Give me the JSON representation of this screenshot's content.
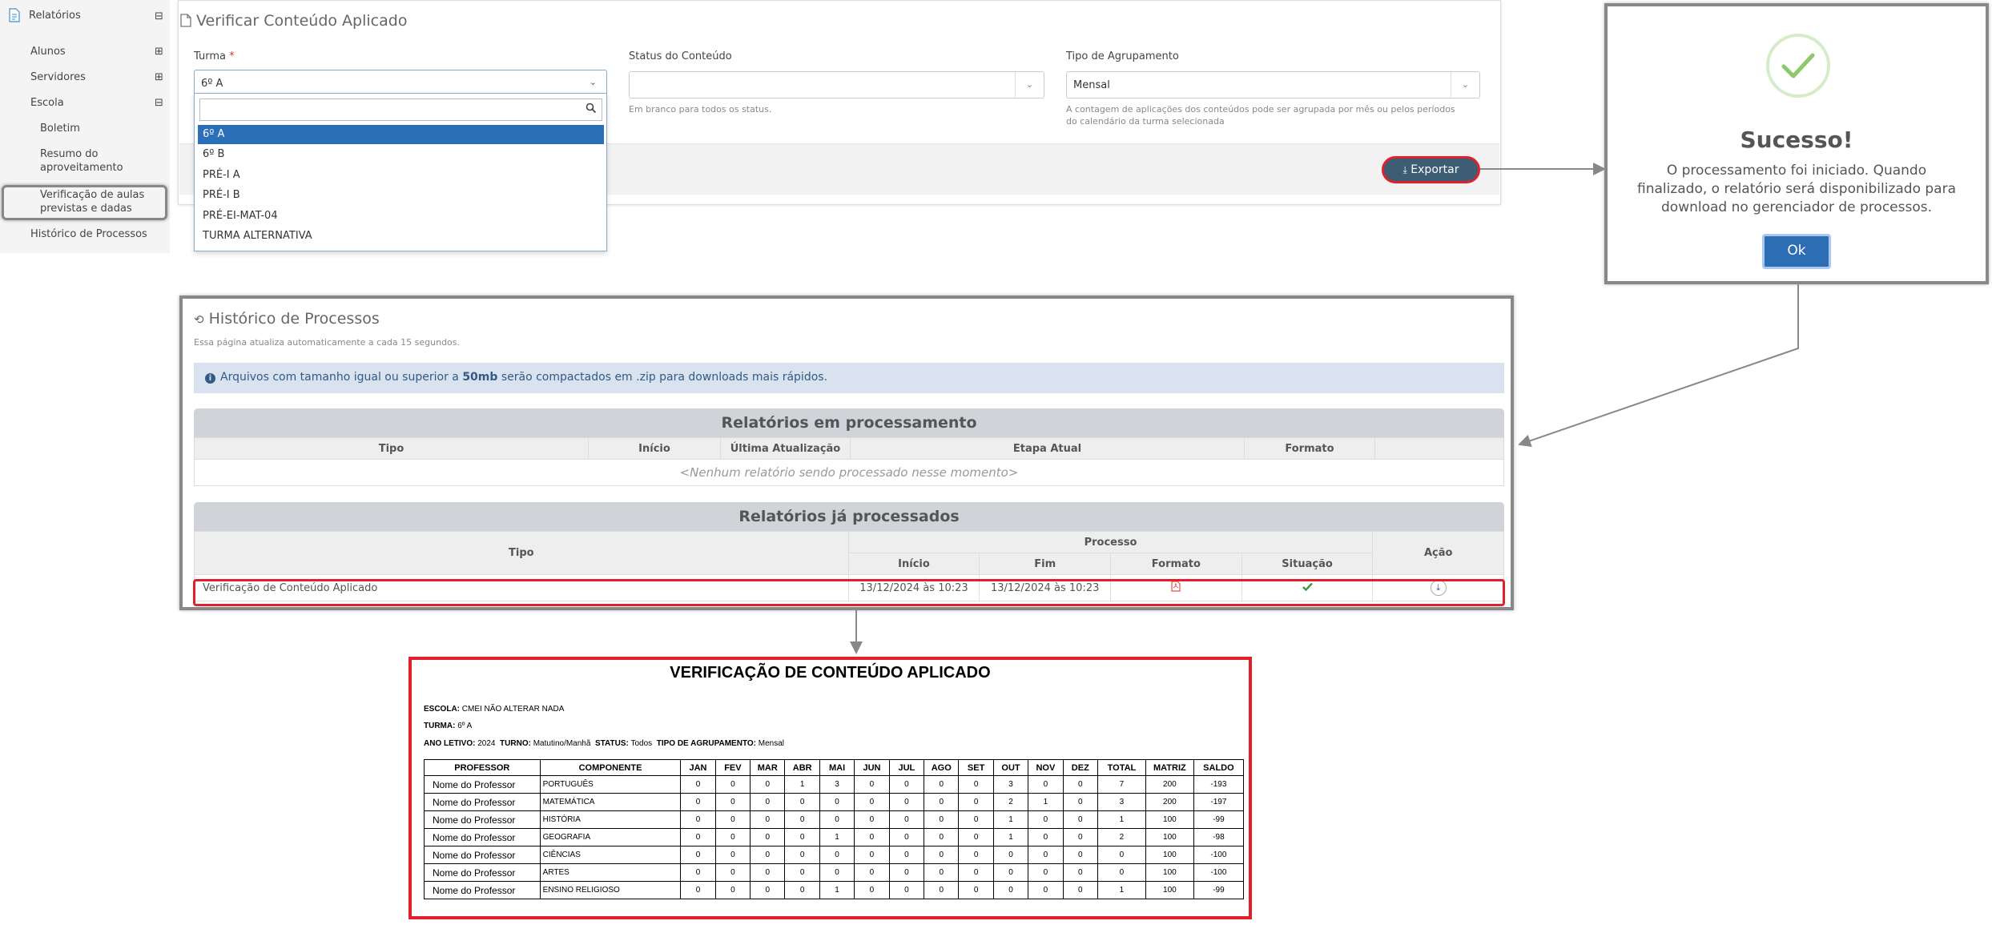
{
  "sidebar": {
    "reports": "Relatórios",
    "items": [
      {
        "label": "Alunos"
      },
      {
        "label": "Servidores"
      },
      {
        "label": "Escola"
      },
      {
        "label": "Boletim"
      },
      {
        "label": "Resumo do aproveitamento"
      },
      {
        "label": "Verificação de aulas previstas e dadas"
      },
      {
        "label": "Histórico de Processos"
      }
    ],
    "toggles": {
      "expanded": "⊟",
      "collapsed": "⊞"
    }
  },
  "form": {
    "title": "Verificar Conteúdo Aplicado",
    "turma": {
      "label": "Turma",
      "required_mark": "*",
      "value": "6º A"
    },
    "status": {
      "label": "Status do Conteúdo",
      "value": "",
      "help": "Em branco para todos os status."
    },
    "agrupamento": {
      "label": "Tipo de Agrupamento",
      "value": "Mensal",
      "help": "A contagem de aplicações dos conteúdos pode ser agrupada por mês ou pelos períodos do calendário da turma selecionada"
    },
    "export_label": "Exportar",
    "dropdown_options": [
      "6º A",
      "6º B",
      "PRÉ-I A",
      "PRÉ-I B",
      "PRÉ-EI-MAT-04",
      "TURMA ALTERNATIVA"
    ]
  },
  "modal": {
    "title": "Sucesso!",
    "message": "O processamento foi iniciado. Quando finalizado, o relatório será disponibilizado para download no gerenciador de processos.",
    "ok_label": "Ok"
  },
  "history": {
    "title": "Histórico de Processos",
    "subtitle": "Essa página atualiza automaticamente a cada 15 segundos.",
    "info_prefix": "Arquivos com tamanho igual ou superior a ",
    "info_bold": "50mb",
    "info_suffix": " serão compactados em .zip para downloads mais rápidos.",
    "processing": {
      "heading": "Relatórios em processamento",
      "columns": [
        "Tipo",
        "Início",
        "Última Atualização",
        "Etapa Atual",
        "Formato",
        ""
      ],
      "empty": "<Nenhum relatório sendo processado nesse momento>"
    },
    "processed": {
      "heading": "Relatórios já processados",
      "col_tipo": "Tipo",
      "col_processo": "Processo",
      "col_acao": "Ação",
      "sub_columns": [
        "Início",
        "Fim",
        "Formato",
        "Situação"
      ],
      "row": {
        "tipo": "Verificação de Conteúdo Aplicado",
        "inicio": "13/12/2024 às 10:23",
        "fim": "13/12/2024 às 10:23"
      }
    }
  },
  "report": {
    "title": "VERIFICAÇÃO DE CONTEÚDO APLICADO",
    "escola_label": "ESCOLA:",
    "escola": "CMEI NÃO ALTERAR NADA",
    "turma_label": "TURMA:",
    "turma": "6º A",
    "ano_label": "ANO LETIVO:",
    "ano": "2024",
    "turno_label": "TURNO:",
    "turno": "Matutino/Manhã",
    "status_label": "STATUS:",
    "status": "Todos",
    "agrup_label": "TIPO DE AGRUPAMENTO:",
    "agrup": "Mensal",
    "columns": [
      "PROFESSOR",
      "COMPONENTE",
      "JAN",
      "FEV",
      "MAR",
      "ABR",
      "MAI",
      "JUN",
      "JUL",
      "AGO",
      "SET",
      "OUT",
      "NOV",
      "DEZ",
      "TOTAL",
      "MATRIZ",
      "SALDO"
    ],
    "rows": [
      [
        "Nome do Professor",
        "PORTUGUÊS",
        "0",
        "0",
        "0",
        "1",
        "3",
        "0",
        "0",
        "0",
        "0",
        "3",
        "0",
        "0",
        "7",
        "200",
        "-193"
      ],
      [
        "Nome do Professor",
        "MATEMÁTICA",
        "0",
        "0",
        "0",
        "0",
        "0",
        "0",
        "0",
        "0",
        "0",
        "2",
        "1",
        "0",
        "3",
        "200",
        "-197"
      ],
      [
        "Nome do Professor",
        "HISTÓRIA",
        "0",
        "0",
        "0",
        "0",
        "0",
        "0",
        "0",
        "0",
        "0",
        "1",
        "0",
        "0",
        "1",
        "100",
        "-99"
      ],
      [
        "Nome do Professor",
        "GEOGRAFIA",
        "0",
        "0",
        "0",
        "0",
        "1",
        "0",
        "0",
        "0",
        "0",
        "1",
        "0",
        "0",
        "2",
        "100",
        "-98"
      ],
      [
        "Nome do Professor",
        "CIÊNCIAS",
        "0",
        "0",
        "0",
        "0",
        "0",
        "0",
        "0",
        "0",
        "0",
        "0",
        "0",
        "0",
        "0",
        "100",
        "-100"
      ],
      [
        "Nome do Professor",
        "ARTES",
        "0",
        "0",
        "0",
        "0",
        "0",
        "0",
        "0",
        "0",
        "0",
        "0",
        "0",
        "0",
        "0",
        "100",
        "-100"
      ],
      [
        "Nome do Professor",
        "ENSINO RELIGIOSO",
        "0",
        "0",
        "0",
        "0",
        "1",
        "0",
        "0",
        "0",
        "0",
        "0",
        "0",
        "0",
        "1",
        "100",
        "-99"
      ]
    ]
  },
  "colors": {
    "accent": "#2a6fb8",
    "highlight": "#e0202a",
    "export_bg": "#3d5d75",
    "success": "#6ab04c",
    "pdf": "#d9534f"
  }
}
